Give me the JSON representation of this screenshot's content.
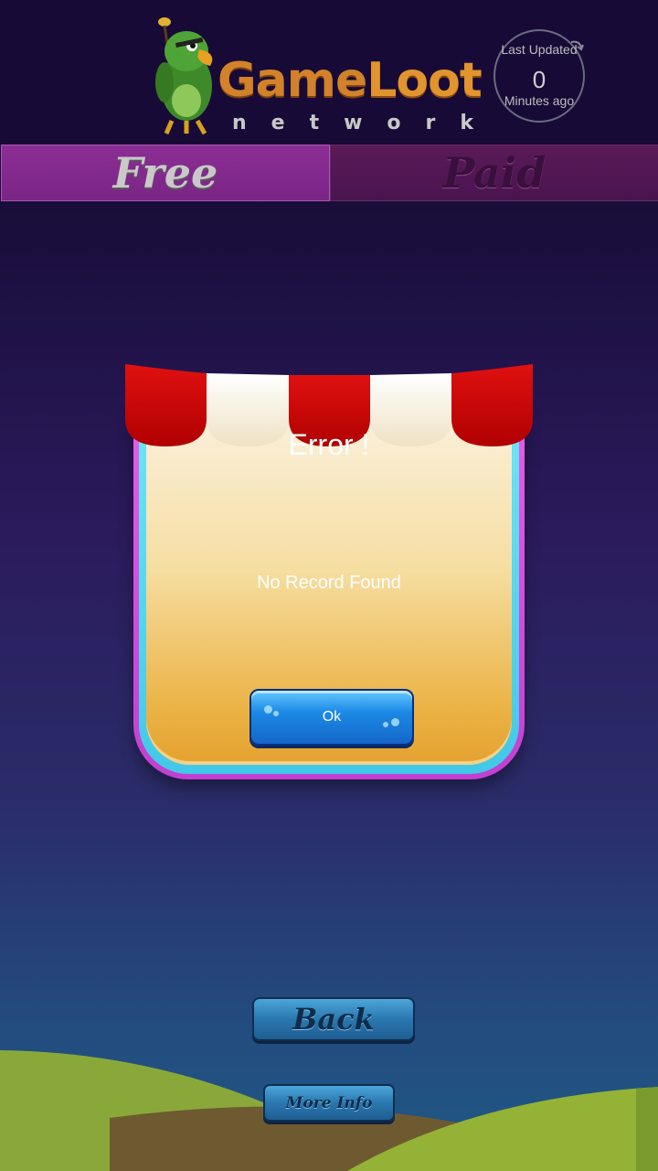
{
  "header": {
    "logo_part1": "Game",
    "logo_part2": "Loot",
    "logo_sub": "network",
    "updated_line1": "Last Updated",
    "updated_value": "0",
    "updated_line3": "Minutes ago",
    "mascot_icon": "parrot-mascot-icon",
    "refresh_icon": "refresh-arrow-icon"
  },
  "tabs": [
    {
      "label": "Free",
      "active": true
    },
    {
      "label": "Paid",
      "active": false
    }
  ],
  "dialog": {
    "title": "Error !",
    "message": "No Record Found",
    "ok_label": "Ok"
  },
  "footer": {
    "back_label": "Back",
    "more_info_label": "More Info"
  },
  "colors": {
    "tab_active": "#8c2e95",
    "tab_inactive": "#4a1450",
    "button_blue": "#1c8ae6",
    "awning_red": "#d40c0c",
    "awning_white": "#fbf4e6"
  }
}
